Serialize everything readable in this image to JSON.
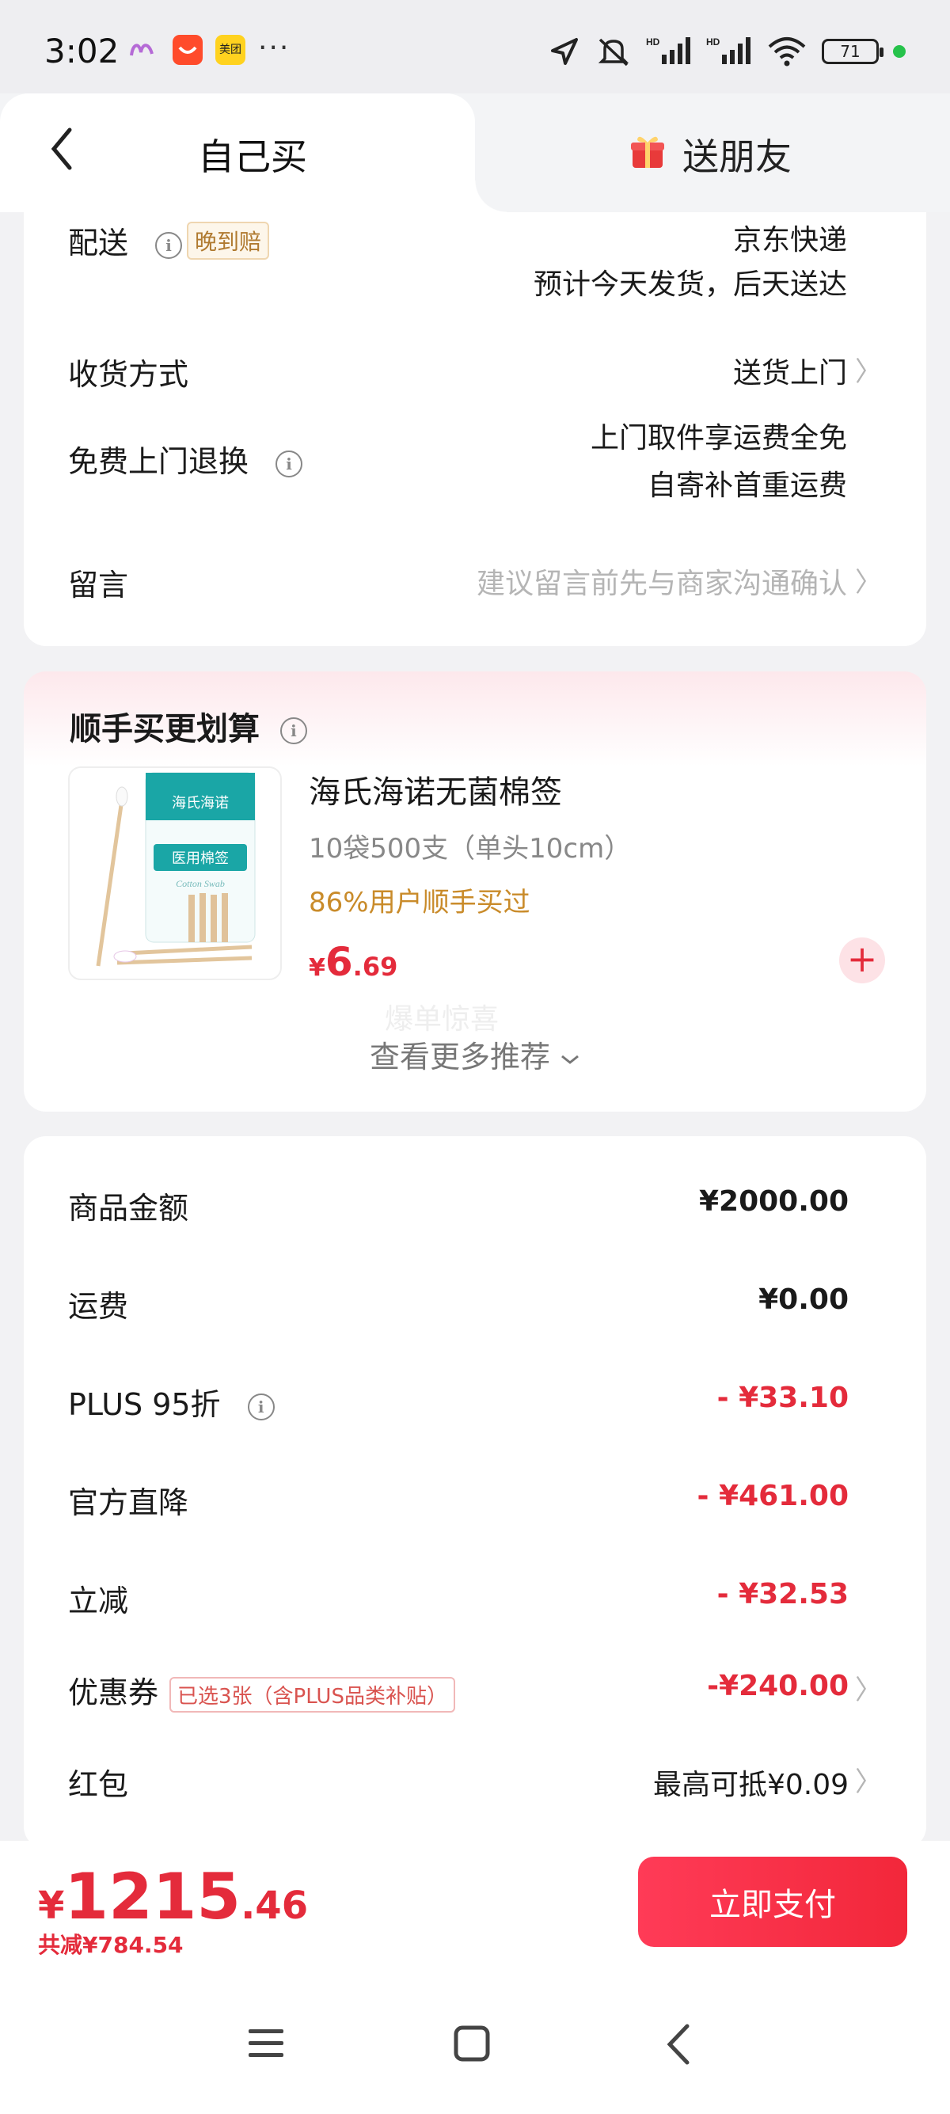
{
  "status_bar": {
    "time": "3:02",
    "more": "···",
    "battery": "71"
  },
  "tabs": {
    "self": "自己买",
    "gift": "送朋友"
  },
  "delivery": {
    "shipping_label": "配送",
    "late_tag": "晚到赔",
    "carrier": "京东快递",
    "eta": "预计今天发货，后天送达",
    "method_label": "收货方式",
    "method_value": "送货上门",
    "return_label": "免费上门退换",
    "return_line1": "上门取件享运费全免",
    "return_line2": "自寄补首重运费",
    "note_label": "留言",
    "note_placeholder": "建议留言前先与商家沟通确认"
  },
  "recommend": {
    "title": "顺手买更划算",
    "product_name": "海氏海诺无菌棉签",
    "product_spec": "10袋500支（单头10cm）",
    "bought": "86%用户顺手买过",
    "price_symbol": "¥",
    "price_int": "6",
    "price_dec": ".69",
    "add": "+",
    "watermark": "爆单惊喜",
    "more": "查看更多推荐",
    "thumb_brand": "海氏海诺",
    "thumb_name": "医用棉签",
    "thumb_sub": "Cotton Swab"
  },
  "summary": {
    "goods_label": "商品金额",
    "goods_value": "¥2000.00",
    "freight_label": "运费",
    "freight_value": "¥0.00",
    "plus_label": "PLUS 95折",
    "plus_value": "- ¥33.10",
    "official_label": "官方直降",
    "official_value": "- ¥461.00",
    "instant_label": "立减",
    "instant_value": "- ¥32.53",
    "coupon_label": "优惠券",
    "coupon_tag": "已选3张（含PLUS品类补贴）",
    "coupon_value": "-¥240.00",
    "redpacket_label": "红包",
    "redpacket_value": "最高可抵¥0.09"
  },
  "footer": {
    "symbol": "¥",
    "total_int": "1215",
    "total_dec": ".46",
    "saved": "共减¥784.54",
    "pay": "立即支付"
  },
  "colors": {
    "accent": "#e42b3b",
    "orange": "#c98b2a",
    "gray": "#888888"
  }
}
